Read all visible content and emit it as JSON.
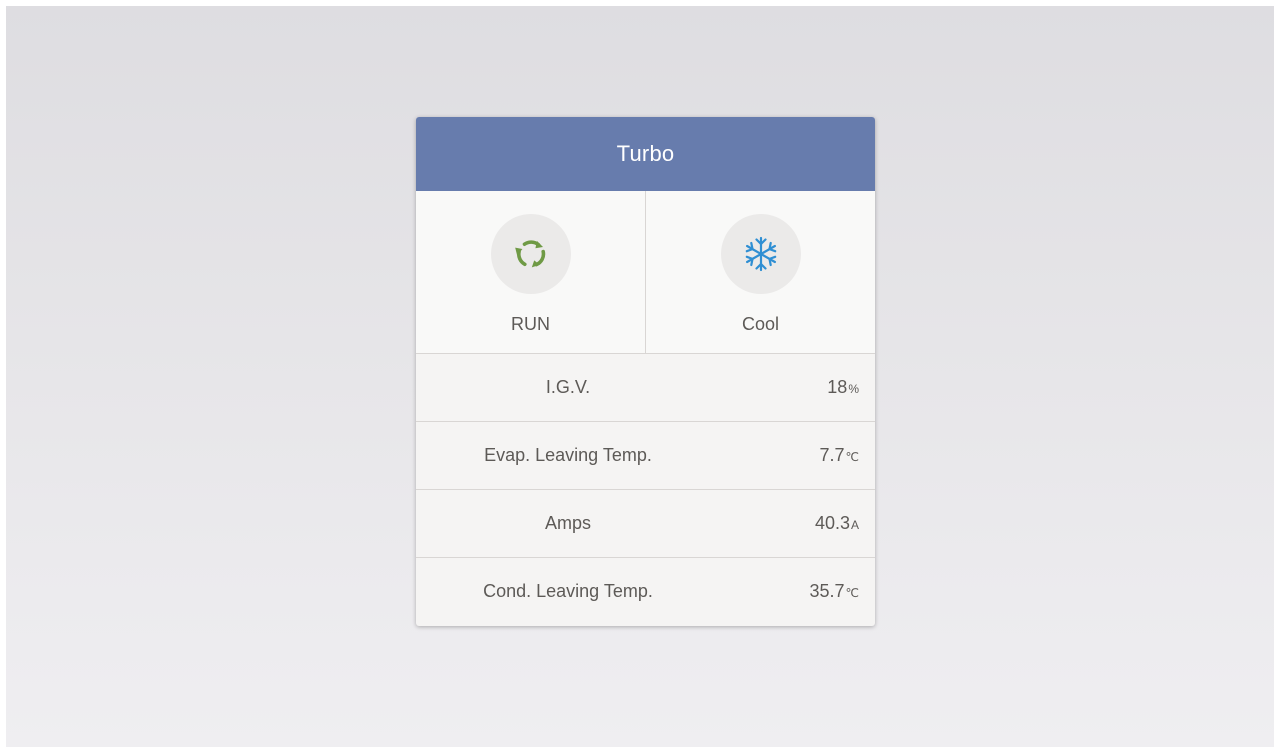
{
  "card": {
    "title": "Turbo",
    "status": {
      "run": {
        "label": "RUN",
        "icon": "run-cycle-icon",
        "color": "#6f9a45"
      },
      "mode": {
        "label": "Cool",
        "icon": "snowflake-icon",
        "color": "#2f8fd3"
      }
    },
    "rows": [
      {
        "label": "I.G.V.",
        "value": "18",
        "unit": "%"
      },
      {
        "label": "Evap. Leaving Temp.",
        "value": "7.7",
        "unit": "℃"
      },
      {
        "label": "Amps",
        "value": "40.3",
        "unit": "A"
      },
      {
        "label": "Cond. Leaving Temp.",
        "value": "35.7",
        "unit": "℃"
      }
    ]
  },
  "colors": {
    "header": "#677cad",
    "text": "#5d5a57",
    "card_background": "#f5f4f3"
  }
}
